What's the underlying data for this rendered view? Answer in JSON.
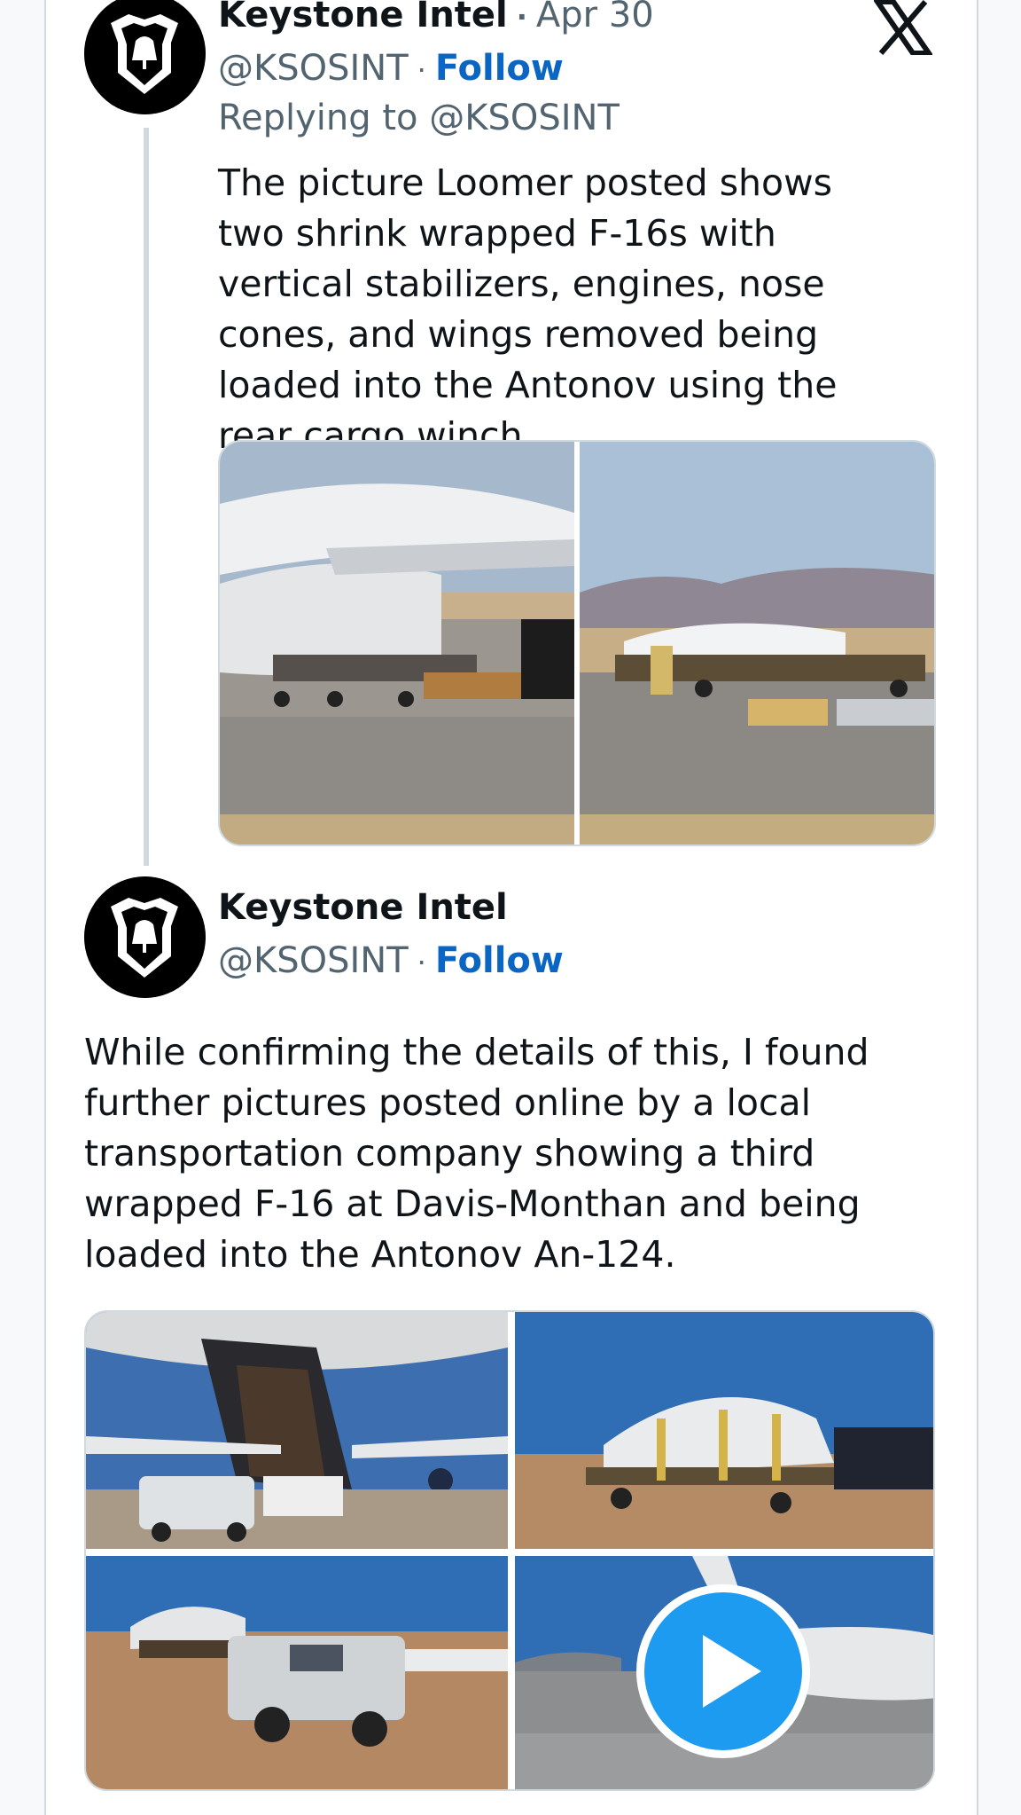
{
  "brand": {
    "logo_icon": "x-logo-icon"
  },
  "tweet1": {
    "author_name": "Keystone Intel",
    "date": "Apr 30",
    "handle": "@KSOSINT",
    "follow_label": "Follow",
    "reply_to": "Replying to @KSOSINT",
    "text": "The picture Loomer posted shows two shrink wrapped F-16s with vertical stabilizers, engines, nose cones, and wings removed being loaded into the Antonov using the rear cargo winch.",
    "media_count": 2
  },
  "tweet2": {
    "author_name": "Keystone Intel",
    "handle": "@KSOSINT",
    "follow_label": "Follow",
    "text": "While confirming the details of this, I found further pictures posted online by a local transportation company showing a third wrapped F-16 at Davis-Monthan and being loaded into the Antonov An-124.",
    "media_count": 4,
    "video_icon": "play-icon"
  },
  "colors": {
    "follow": "#0b66c3",
    "secondary_text": "#536471",
    "border": "#cfd9de",
    "play_button": "#1d9bf0"
  }
}
